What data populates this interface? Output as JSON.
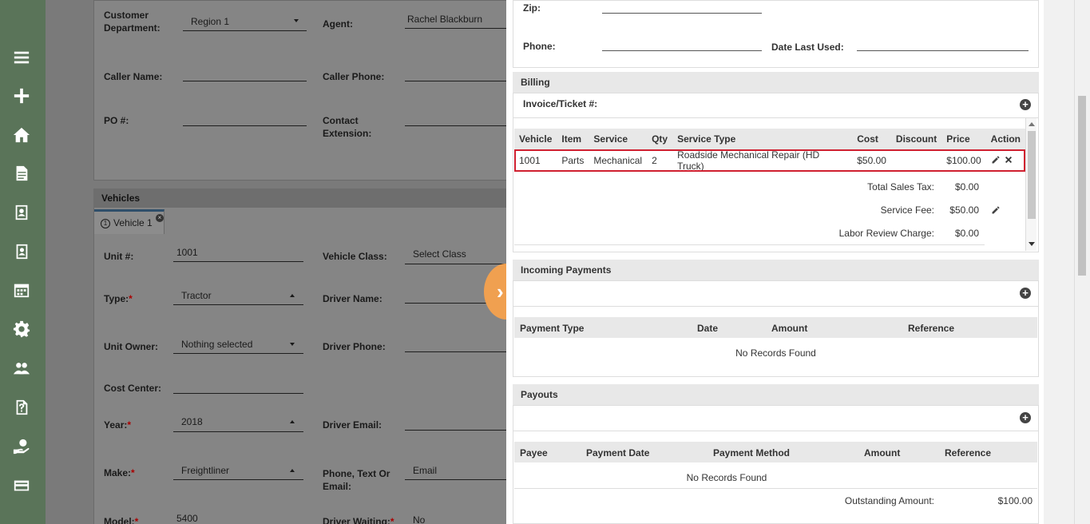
{
  "sidebar": {
    "icons": [
      "menu-icon",
      "plus-icon",
      "home-icon",
      "document-icon",
      "contact-card-icon",
      "address-book-icon",
      "calendar-icon",
      "gear-icon",
      "users-icon",
      "help-document-icon",
      "payment-hand-icon",
      "credit-card-icon"
    ]
  },
  "bg_form": {
    "customer_department_label": "Customer Department:",
    "customer_department_value": "Region 1",
    "agent_label": "Agent:",
    "agent_value": "Rachel Blackburn",
    "caller_name_label": "Caller Name:",
    "caller_phone_label": "Caller Phone:",
    "po_label": "PO #:",
    "contact_extension_label": "Contact Extension:",
    "vehicles_header": "Vehicles",
    "vehicle_tab_num": "1",
    "vehicle_tab_label": "Vehicle 1",
    "unit_label": "Unit #:",
    "unit_value": "1001",
    "vehicle_class_label": "Vehicle Class:",
    "vehicle_class_value": "Select Class",
    "type_label": "Type:",
    "type_value": "Tractor",
    "driver_name_label": "Driver Name:",
    "unit_owner_label": "Unit Owner:",
    "unit_owner_value": "Nothing selected",
    "driver_phone_label": "Driver Phone:",
    "cost_center_label": "Cost Center:",
    "year_label": "Year:",
    "year_value": "2018",
    "driver_email_label": "Driver Email:",
    "make_label": "Make:",
    "make_value": "Freightliner",
    "phone_text_email_label": "Phone, Text Or Email:",
    "phone_text_email_value": "Email",
    "model_label": "Model:",
    "model_value": "5400",
    "driver_waiting_label": "Driver Waiting:",
    "driver_waiting_value": "No",
    "required_mark": "*"
  },
  "location": {
    "zip_label": "Zip:",
    "phone_label": "Phone:",
    "date_last_used_label": "Date Last Used:"
  },
  "billing": {
    "header": "Billing",
    "invoice_label": "Invoice/Ticket #:",
    "columns": [
      "Vehicle",
      "Item",
      "Service",
      "Qty",
      "Service Type",
      "Cost",
      "Discount",
      "Price",
      "Action"
    ],
    "rows": [
      {
        "vehicle": "1001",
        "item": "Parts",
        "service": "Mechanical",
        "qty": "2",
        "service_type": "Roadside Mechanical Repair (HD Truck)",
        "cost": "$50.00",
        "discount": "",
        "price": "$100.00"
      }
    ],
    "total_sales_tax_label": "Total Sales Tax:",
    "total_sales_tax_value": "$0.00",
    "service_fee_label": "Service Fee:",
    "service_fee_value": "$50.00",
    "labor_review_label": "Labor Review Charge:",
    "labor_review_value": "$0.00"
  },
  "incoming_payments": {
    "header": "Incoming Payments",
    "columns": [
      "Payment Type",
      "Date",
      "Amount",
      "Reference"
    ],
    "empty_text": "No Records Found"
  },
  "payouts": {
    "header": "Payouts",
    "columns": [
      "Payee",
      "Payment Date",
      "Payment Method",
      "Amount",
      "Reference"
    ],
    "empty_text": "No Records Found",
    "outstanding_label": "Outstanding Amount:",
    "outstanding_value": "$100.00"
  },
  "colors": {
    "sidebar": "#5a7459",
    "highlight": "#d02030",
    "toggle": "#f0a050"
  }
}
